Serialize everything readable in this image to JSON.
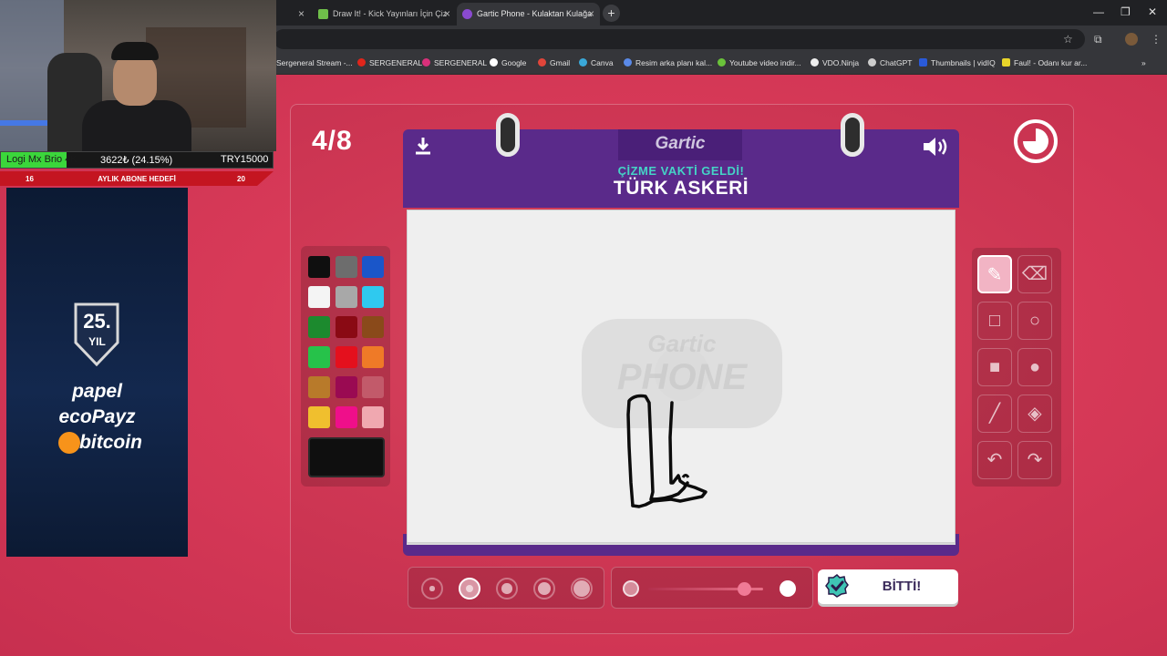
{
  "browser": {
    "tabs": [
      {
        "label": "",
        "active": false
      },
      {
        "label": "Draw It! - Kick Yayınları İçin Çiz",
        "active": false
      },
      {
        "label": "Gartic Phone - Kulaktan Kulağa",
        "active": true
      }
    ],
    "bookmarks": [
      "Sergeneral Stream -...",
      "SERGENERAL",
      "SERGENERAL",
      "Google",
      "Gmail",
      "Canva",
      "Resim arka planı kal...",
      "Youtube video indir...",
      "VDO.Ninja",
      "ChatGPT",
      "Thumbnails | vidIQ",
      "Faul! - Odanı kur ar..."
    ]
  },
  "stream": {
    "device": "Logi Mx Brio 4K",
    "goal_current": "3622₺ (24.15%)",
    "goal_target": "TRY15000",
    "sub_goal_label": "AYLIK ABONE HEDEFİ",
    "sub_goal_left": "16",
    "sub_goal_right": "20",
    "badge_top": "25.",
    "badge_bottom": "YIL",
    "sponsors": [
      "papel",
      "ecoPayz",
      "bitcoin"
    ]
  },
  "game": {
    "round": "4/8",
    "logo": "Gartic",
    "subtitle": "ÇİZME VAKTİ GELDİ!",
    "word": "TÜRK ASKERİ",
    "watermark_top": "Gartic",
    "watermark_bottom": "PHONE",
    "done_label": "BİTTİ!",
    "timer_progress": 0.75,
    "colors": [
      "#0f0f0f",
      "#6d6d6d",
      "#1a56c9",
      "#f4f4f4",
      "#a8a8a8",
      "#2fc9ef",
      "#1c8a2e",
      "#8a0a14",
      "#8a4a1a",
      "#26c24a",
      "#e4101d",
      "#ef7a27",
      "#b87a2a",
      "#9a0a52",
      "#c25a6a",
      "#f0bf2e",
      "#ef0f8a",
      "#f0a8b0"
    ],
    "selected_color": "#0f0f0f",
    "tools": [
      "pencil-icon",
      "eraser-icon",
      "rect-outline-icon",
      "circle-outline-icon",
      "rect-fill-icon",
      "circle-fill-icon",
      "line-icon",
      "bucket-icon",
      "undo-icon",
      "redo-icon"
    ],
    "brush_sizes": [
      1,
      2,
      3,
      4,
      5
    ],
    "selected_brush_size": 2,
    "opacity_level": 0.83
  }
}
